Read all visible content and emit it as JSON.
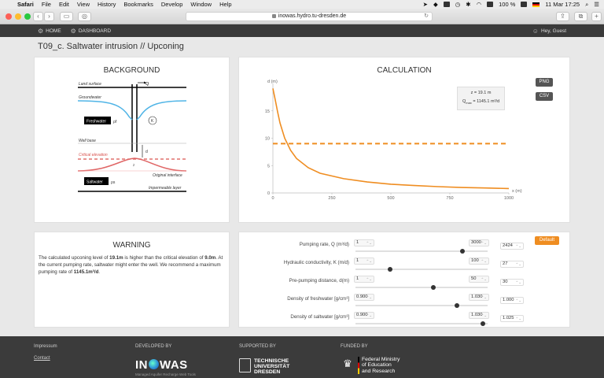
{
  "menubar": {
    "app": "Safari",
    "items": [
      "File",
      "Edit",
      "View",
      "History",
      "Bookmarks",
      "Develop",
      "Window",
      "Help"
    ],
    "battery": "100 %",
    "clock": "11 Mar  17:25"
  },
  "browser": {
    "url": "inowas.hydro.tu-dresden.de"
  },
  "appnav": {
    "home": "HOME",
    "dashboard": "DASHBOARD",
    "guest": "Hey, Guest"
  },
  "page_title": "T09_c. Saltwater intrusion // Upconing",
  "background": {
    "title": "BACKGROUND",
    "labels": {
      "land_surface": "Land surface",
      "q": "Q",
      "groundwater": "Groundwater",
      "freshwater": "Freshwater",
      "rho_f": "ρf",
      "k": "K",
      "well_base": "Well base",
      "d": "d",
      "critical": "Critical elevation",
      "z": "z",
      "original": "Original interface",
      "saltwater": "Saltwater",
      "rho_s": "ρs",
      "impermeable": "Impermeable layer"
    }
  },
  "calculation": {
    "title": "CALCULATION",
    "png": "PNG",
    "csv": "CSV",
    "info_z": "z = 19.1  m",
    "info_q_prefix": "Q",
    "info_q_sub": "max",
    "info_q_value": " = 1145.1 m³/d"
  },
  "chart_data": {
    "type": "line",
    "ylabel": "d (m)",
    "xlabel": "x (m)",
    "xlim": [
      0,
      1000
    ],
    "ylim": [
      0,
      20
    ],
    "xticks": [
      0,
      250,
      500,
      750,
      1000
    ],
    "yticks": [
      0,
      5,
      10,
      15
    ],
    "series": [
      {
        "style": "solid",
        "x": [
          0,
          10,
          20,
          30,
          50,
          75,
          100,
          150,
          200,
          300,
          400,
          500,
          600,
          700,
          800,
          900,
          1000
        ],
        "y": [
          19.1,
          17.0,
          14.8,
          12.8,
          10.0,
          7.8,
          6.3,
          4.6,
          3.6,
          2.6,
          2.0,
          1.6,
          1.35,
          1.15,
          1.0,
          0.9,
          0.8
        ]
      },
      {
        "style": "dashed",
        "x": [
          0,
          1000
        ],
        "y": [
          9.0,
          9.0
        ]
      }
    ],
    "colors": {
      "line": "#ef8d21"
    }
  },
  "warning": {
    "title": "WARNING",
    "t1": "The calculated upconing level of ",
    "b1": "19.1m",
    "t2": " is higher than the critical elevation of ",
    "b2": "9.0m",
    "t3": ". At the current pumping rate, saltwater might enter the well. We recommend a maximum pumping rate of ",
    "b3": "1145.1m³/d",
    "t4": "."
  },
  "params": {
    "default_btn": "Default",
    "rows": [
      {
        "label": "Pumping rate, Q (m³/d)",
        "min": "1",
        "max": "3000",
        "value": "2424",
        "fraction": 0.808
      },
      {
        "label": "Hydraulic conductivity, K (m/d)",
        "min": "1",
        "max": "100",
        "value": "27",
        "fraction": 0.263
      },
      {
        "label": "Pre-pumping distance, d(m)",
        "min": "1",
        "max": "50",
        "value": "30",
        "fraction": 0.592
      },
      {
        "label": "Density of freshwater [g/cm³]",
        "min": "0.900",
        "max": "1.030",
        "value": "1.000",
        "fraction": 0.769
      },
      {
        "label": "Density of saltwater [g/cm³]",
        "min": "0.900",
        "max": "1.030",
        "value": "1.025",
        "fraction": 0.962
      }
    ]
  },
  "footer": {
    "impressum": "Impressum",
    "contact": "Contact",
    "developed_by": "DEVELOPED BY",
    "supported_by": "SUPPORTED BY",
    "funded_by": "FUNDED BY",
    "inowas_left": "IN",
    "inowas_right": "WAS",
    "inowas_sub": "Managed Aquifer Recharge Web Tools",
    "tud": [
      "TECHNISCHE",
      "UNIVERSITÄT",
      "DRESDEN"
    ],
    "bmbf": [
      "Federal Ministry",
      "of Education",
      "and Research"
    ]
  }
}
